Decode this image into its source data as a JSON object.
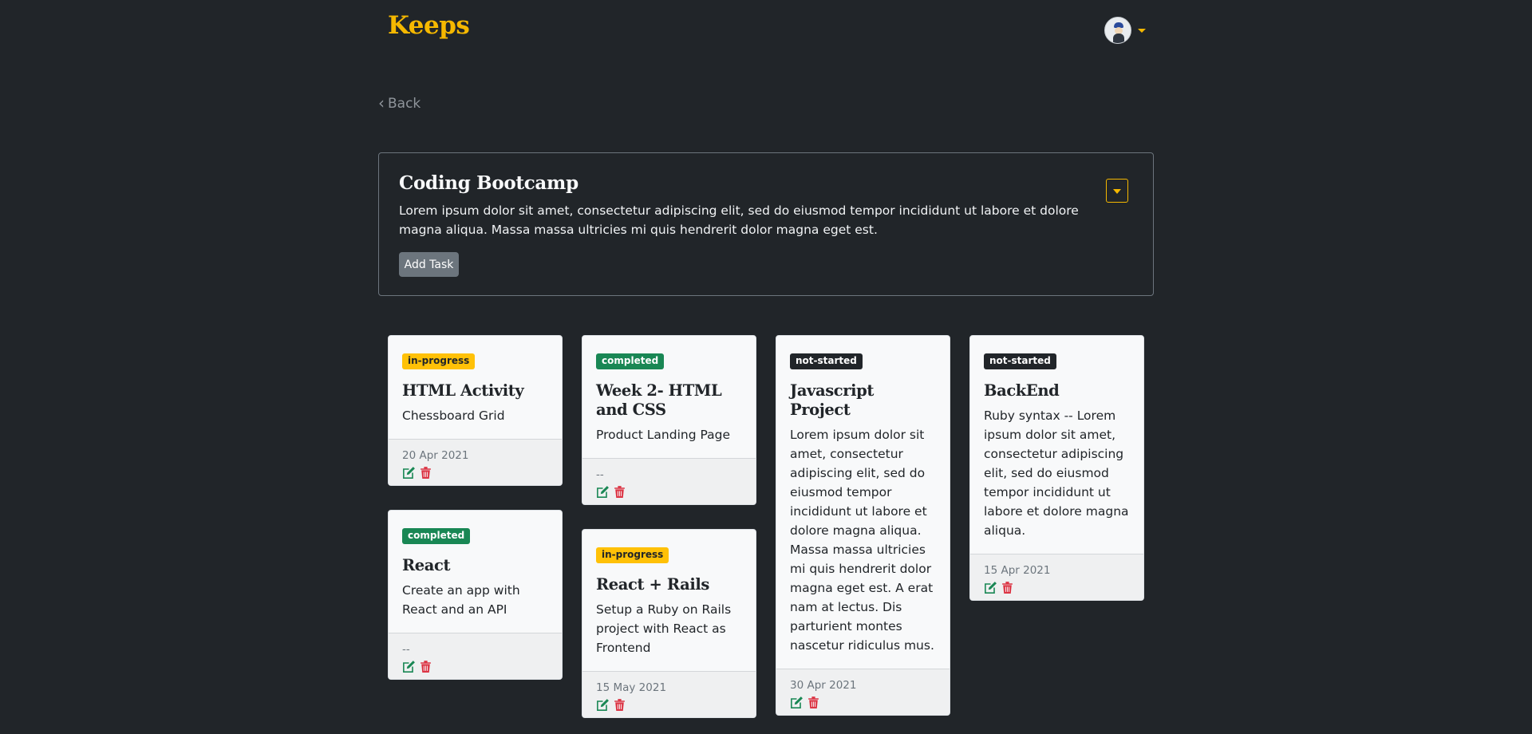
{
  "brand": "Keeps",
  "nav": {
    "back_label": "Back"
  },
  "project": {
    "title": "Coding Bootcamp",
    "description": "Lorem ipsum dolor sit amet, consectetur adipiscing elit, sed do eiusmod tempor incididunt ut labore et dolore magna aliqua. Massa massa ultricies mi quis hendrerit dolor magna eget est.",
    "add_task_label": "Add Task"
  },
  "colors": {
    "accent": "#f5b800",
    "background": "#212529",
    "status_in_progress": "#ffc107",
    "status_completed": "#198754",
    "status_not_started": "#212529",
    "edit_icon": "#198754",
    "delete_icon": "#dc3545"
  },
  "tasks": [
    {
      "status": "in-progress",
      "title": "HTML Activity",
      "description": "Chessboard Grid",
      "due": "20 Apr 2021"
    },
    {
      "status": "completed",
      "title": "React",
      "description": "Create an app with React and an API",
      "due": "--"
    },
    {
      "status": "completed",
      "title": "Week 2- HTML and CSS",
      "description": "Product Landing Page",
      "due": "--"
    },
    {
      "status": "in-progress",
      "title": "React + Rails",
      "description": "Setup a Ruby on Rails project with React as Frontend",
      "due": "15 May 2021"
    },
    {
      "status": "not-started",
      "title": "Javascript Project",
      "description": "Lorem ipsum dolor sit amet, consectetur adipiscing elit, sed do eiusmod tempor incididunt ut labore et dolore magna aliqua. Massa massa ultricies mi quis hendrerit dolor magna eget est. A erat nam at lectus. Dis parturient montes nascetur ridiculus mus.",
      "due": "30 Apr 2021"
    },
    {
      "status": "not-started",
      "title": "BackEnd",
      "description": "Ruby syntax -- Lorem ipsum dolor sit amet, consectetur adipiscing elit, sed do eiusmod tempor incididunt ut labore et dolore magna aliqua.",
      "due": "15 Apr 2021"
    }
  ],
  "icons": {
    "user_menu": "avatar-icon",
    "edit": "edit-icon",
    "delete": "trash-icon",
    "back": "chevron-left-icon",
    "project_menu": "chevron-down-icon"
  }
}
